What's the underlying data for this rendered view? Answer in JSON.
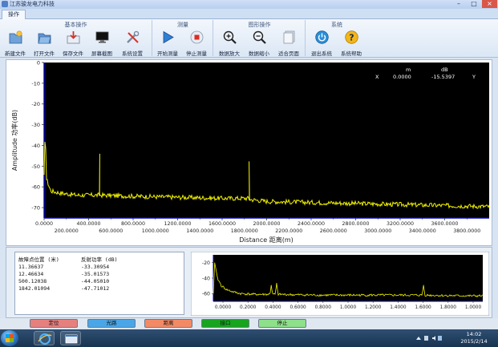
{
  "window": {
    "title": "江苏骏龙电力科技",
    "minimize": "–",
    "maximize": "□",
    "close": "×"
  },
  "tabs": [
    {
      "label": "操作"
    }
  ],
  "ribbon": {
    "groups": [
      {
        "title": "基本操作"
      },
      {
        "title": "测量"
      },
      {
        "title": "图形操作"
      },
      {
        "title": "系统"
      }
    ],
    "buttons": [
      {
        "label": "新建文件",
        "icon": "folder-new-icon"
      },
      {
        "label": "打开文件",
        "icon": "folder-open-icon"
      },
      {
        "label": "保存文件",
        "icon": "save-icon"
      },
      {
        "label": "屏幕截图",
        "icon": "monitor-icon"
      },
      {
        "label": "系统设置",
        "icon": "tools-icon"
      },
      {
        "label": "开始测量",
        "icon": "play-icon"
      },
      {
        "label": "停止测量",
        "icon": "stop-icon"
      },
      {
        "label": "数据放大",
        "icon": "zoom-in-icon"
      },
      {
        "label": "数据缩小",
        "icon": "zoom-out-icon"
      },
      {
        "label": "适合页面",
        "icon": "fit-page-icon"
      },
      {
        "label": "退出系统",
        "icon": "power-icon"
      },
      {
        "label": "系统帮助",
        "icon": "help-icon"
      }
    ]
  },
  "readout": {
    "header_m": "m",
    "header_db": "dB",
    "label_x": "X",
    "value_m": "0.0000",
    "value_db": "-15.5397",
    "label_y": "Y"
  },
  "main_chart": {
    "ylabel": "Amplitude 功率(dB)",
    "xlabel": "Distance 距离(m)",
    "y_ticks": [
      "0",
      "-10",
      "-20",
      "-30",
      "-40",
      "-50",
      "-60",
      "-70"
    ],
    "x_ticks_top": [
      "0.0000",
      "400.0000",
      "800.0000",
      "1200.0000",
      "1600.0000",
      "2000.0000",
      "2400.0000",
      "2800.0000",
      "3200.0000",
      "3600.0000"
    ],
    "x_ticks_bottom": [
      "200.0000",
      "600.0000",
      "1000.0000",
      "1400.0000",
      "1800.0000",
      "2200.0000",
      "2600.0000",
      "3000.0000",
      "3400.0000",
      "3800.0000"
    ],
    "colors": {
      "background": "#000000",
      "trace": "#f2f200",
      "axis": "#0000c8",
      "text": "#ffffff"
    }
  },
  "table": {
    "headers": [
      "故障点位置 (米)",
      "反射功率 (dB)"
    ],
    "rows": [
      [
        "11.36637",
        "-33.30954"
      ],
      [
        "12.46634",
        "-35.01573"
      ],
      [
        "500.12038",
        "-44.05010"
      ],
      [
        "1842.01094",
        "-47.71012"
      ]
    ]
  },
  "mini_chart": {
    "y_ticks": [
      "-20",
      "-40",
      "-60"
    ],
    "x_ticks": [
      "0.0000",
      "0.2000",
      "0.4000",
      "0.6000",
      "0.8000",
      "1.0000",
      "1.2000",
      "1.4000",
      "1.6000",
      "1.8000",
      "1.0000"
    ]
  },
  "action_buttons": [
    {
      "label": "定位",
      "color": "#e6807e"
    },
    {
      "label": "光路",
      "color": "#4aa6e6"
    },
    {
      "label": "距离",
      "color": "#f28a66"
    },
    {
      "label": "接口",
      "color": "#18a41e"
    },
    {
      "label": "停止",
      "color": "#8ee08a"
    }
  ],
  "taskbar": {
    "time": "14:02",
    "date": "2015/2/14"
  },
  "chart_data": [
    {
      "type": "line",
      "title": "",
      "xlabel": "Distance 距离(m)",
      "ylabel": "Amplitude 功率(dB)",
      "xlim": [
        0,
        4000
      ],
      "ylim": [
        -75,
        0
      ],
      "grid": false,
      "series": [
        {
          "x": [
            0,
            10,
            11.37,
            12.47,
            20,
            60,
            150,
            300,
            499,
            500.12,
            501,
            800,
            1200,
            1600,
            1841,
            1842.01,
            1843,
            2000,
            2400,
            2800,
            3200,
            3600,
            4000
          ],
          "y": [
            -55,
            -33,
            -33.31,
            -35.02,
            -56,
            -62,
            -63,
            -64,
            -64,
            -44.05,
            -64,
            -64.5,
            -65,
            -65.5,
            -65.5,
            -47.71,
            -66,
            -67,
            -67.5,
            -68,
            -68.5,
            -69,
            -69.5
          ]
        }
      ]
    },
    {
      "type": "line",
      "title": "",
      "ylim": [
        -70,
        -10
      ],
      "grid": false,
      "series": [
        {
          "x": [
            0,
            0.01,
            0.03,
            0.06,
            0.1,
            0.15,
            0.2,
            0.3,
            0.42,
            0.43,
            0.44,
            0.46,
            0.47,
            0.48,
            0.6,
            0.8,
            1.0,
            1.2,
            1.4,
            1.55,
            1.56,
            1.57,
            1.7,
            1.9
          ],
          "y": [
            -60,
            -20,
            -40,
            -50,
            -55,
            -58,
            -60,
            -61,
            -61,
            -49,
            -61,
            -61,
            -47,
            -61,
            -61.5,
            -62,
            -62,
            -62,
            -62,
            -62,
            -49,
            -62,
            -62.5,
            -63
          ]
        }
      ]
    }
  ]
}
